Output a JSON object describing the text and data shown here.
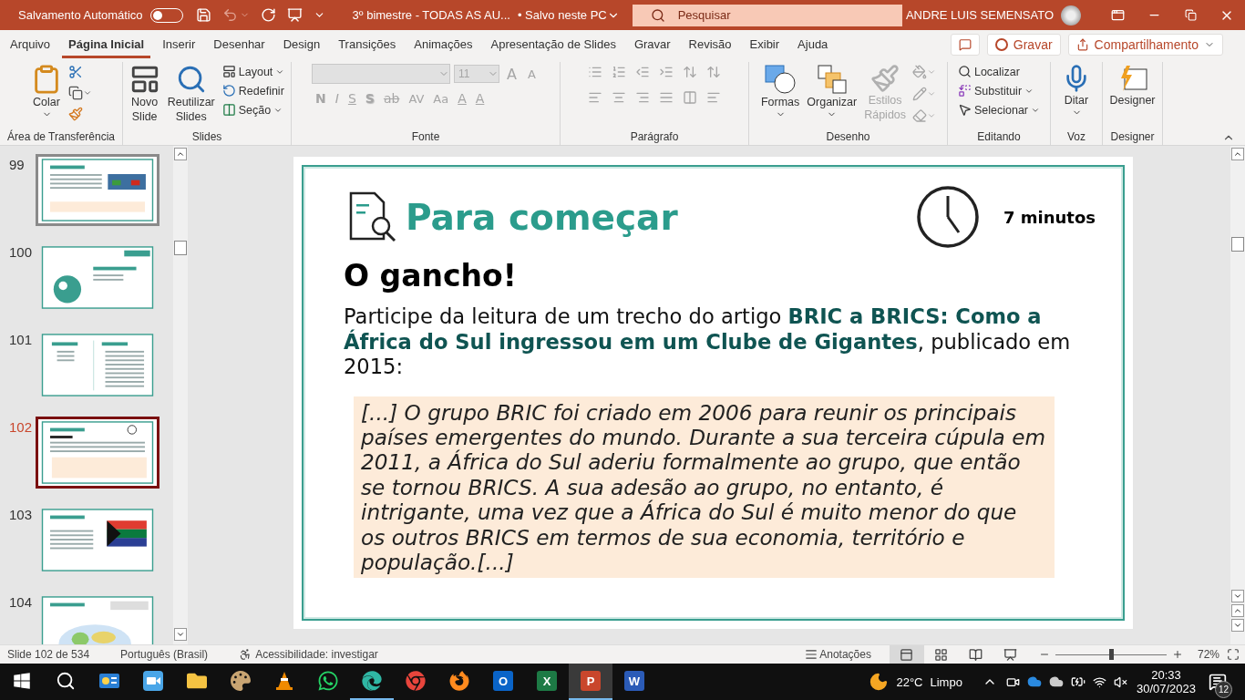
{
  "title_bar": {
    "autosave_label": "Salvamento Automático",
    "autosave_on": false,
    "document": "3º bimestre - TODAS AS AU...",
    "save_status": "• Salvo neste PC",
    "search_placeholder": "Pesquisar",
    "user": "ANDRE LUIS SEMENSATO"
  },
  "menu_tabs": [
    {
      "label": "Arquivo",
      "selected": false
    },
    {
      "label": "Página Inicial",
      "selected": true
    },
    {
      "label": "Inserir",
      "selected": false
    },
    {
      "label": "Desenhar",
      "selected": false
    },
    {
      "label": "Design",
      "selected": false
    },
    {
      "label": "Transições",
      "selected": false
    },
    {
      "label": "Animações",
      "selected": false
    },
    {
      "label": "Apresentação de Slides",
      "selected": false
    },
    {
      "label": "Gravar",
      "selected": false
    },
    {
      "label": "Revisão",
      "selected": false
    },
    {
      "label": "Exibir",
      "selected": false
    },
    {
      "label": "Ajuda",
      "selected": false
    }
  ],
  "record_button": "Gravar",
  "share_button": "Compartilhamento",
  "ribbon": {
    "clipboard": {
      "label": "Área de Transferência",
      "paste": "Colar"
    },
    "slides": {
      "label": "Slides",
      "new_slide": [
        "Novo",
        "Slide"
      ],
      "reuse": [
        "Reutilizar",
        "Slides"
      ],
      "layout": "Layout",
      "reset": "Redefinir",
      "section": "Seção"
    },
    "font": {
      "label": "Fonte",
      "disabled": true,
      "size": "11",
      "grow": "A",
      "shrink": "A",
      "bold": "N",
      "italic": "I",
      "underline": "S",
      "shadow": "S",
      "strike": "ab",
      "spacing": "AV",
      "case": "Aa",
      "highlight": "A",
      "font_color": "A"
    },
    "paragraph": {
      "label": "Parágrafo",
      "disabled": true
    },
    "drawing": {
      "label": "Desenho",
      "shapes": "Formas",
      "arrange": "Organizar",
      "quick_styles": [
        "Estilos",
        "Rápidos"
      ],
      "quick_styles_disabled": true
    },
    "editing": {
      "label": "Editando",
      "find": "Localizar",
      "replace": "Substituir",
      "select": "Selecionar"
    },
    "voice": {
      "label": "Voz",
      "dictate": "Ditar"
    },
    "designer": {
      "label": "Designer",
      "button": "Designer"
    }
  },
  "thumbnails": [
    {
      "number": "99",
      "kind": "focus_photo",
      "selected": false,
      "hovered": true
    },
    {
      "number": "100",
      "kind": "title",
      "selected": false,
      "hovered": false
    },
    {
      "number": "101",
      "kind": "objectives",
      "selected": false,
      "hovered": false
    },
    {
      "number": "102",
      "kind": "hook",
      "selected": true,
      "hovered": false
    },
    {
      "number": "103",
      "kind": "focus_flag",
      "selected": false,
      "hovered": false
    },
    {
      "number": "104",
      "kind": "focus_map",
      "selected": false,
      "hovered": false
    }
  ],
  "slide": {
    "heading": "Para começar",
    "duration": "7 minutos",
    "subtitle": "O gancho!",
    "intro": "Participe da leitura de um trecho do artigo **BRIC a BRICS: Como a África do Sul ingressou em um Clube de Gigantes**, publicado em 2015:",
    "quote": "[...] O grupo BRIC foi criado em 2006 para reunir os principais países emergentes do mundo. Durante a sua terceira cúpula em 2011, a África do Sul aderiu formalmente ao grupo, que então se tornou BRICS. A sua adesão ao grupo, no entanto, é intrigante, uma vez que a África do Sul é muito menor do que os outros BRICS em termos de sua economia, território e população.[...]"
  },
  "status_bar": {
    "slide_count": "Slide 102 de 534",
    "language": "Português (Brasil)",
    "accessibility": "Acessibilidade: investigar",
    "notes": "Anotações",
    "views": [
      {
        "kind": "normal",
        "selected": true
      },
      {
        "kind": "sorter",
        "selected": false
      },
      {
        "kind": "reading",
        "selected": false
      },
      {
        "kind": "show",
        "selected": false
      }
    ],
    "zoom": {
      "level": 0.5,
      "reading": "72%"
    }
  },
  "taskbar": {
    "apps": [
      {
        "kind": "start",
        "active": false,
        "open": false
      },
      {
        "kind": "search",
        "active": false,
        "open": false
      },
      {
        "kind": "news",
        "active": false,
        "open": false
      },
      {
        "kind": "camera",
        "active": false,
        "open": false
      },
      {
        "kind": "folder",
        "active": false,
        "open": false
      },
      {
        "kind": "palette",
        "active": false,
        "open": false
      },
      {
        "kind": "cone",
        "active": false,
        "open": false
      },
      {
        "kind": "chat",
        "active": false,
        "open": false
      },
      {
        "kind": "edge",
        "active": false,
        "open": true
      },
      {
        "kind": "chrome",
        "active": false,
        "open": false
      },
      {
        "kind": "firefox",
        "active": false,
        "open": false
      },
      {
        "kind": "office",
        "letter": "O",
        "color": "#0a64c8",
        "active": false,
        "open": false
      },
      {
        "kind": "office",
        "letter": "X",
        "color": "#1d7a45",
        "active": false,
        "open": false
      },
      {
        "kind": "office",
        "letter": "P",
        "color": "#c9462c",
        "active": true,
        "open": true
      },
      {
        "kind": "office",
        "letter": "W",
        "color": "#2b5bb7",
        "active": false,
        "open": false
      }
    ],
    "temperature": "22°C",
    "weather": "Limpo",
    "time": "20:33",
    "date": "30/07/2023",
    "notifications": "12"
  }
}
